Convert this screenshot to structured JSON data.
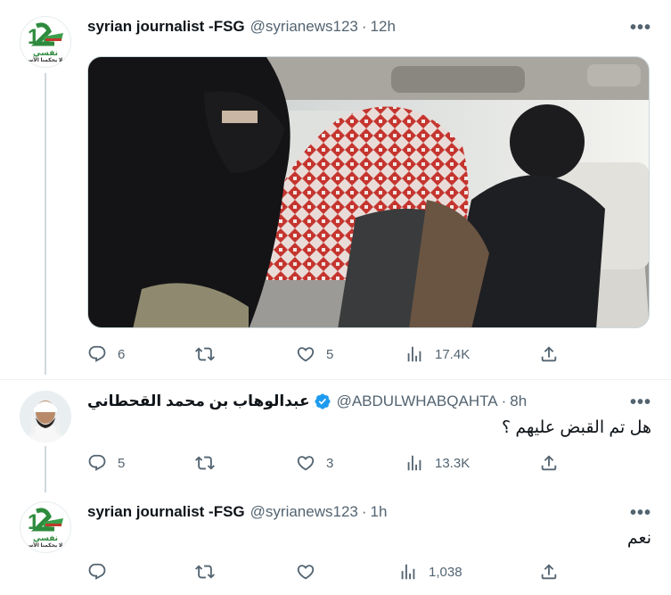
{
  "tweets": [
    {
      "name": "syrian journalist -FSG",
      "handle": "@syrianews123",
      "time": "12h",
      "replies": "6",
      "retweets": "",
      "likes": "5",
      "views": "17.4K",
      "avatar_caption_1": "نفسي",
      "avatar_caption_2": "ولا يحكمنا الأسد"
    },
    {
      "name": "عبدالوهاب بن محمد القحطاني",
      "handle": "@ABDULWHABQAHTA",
      "time": "8h",
      "text": "هل تم القبض عليهم ؟",
      "replies": "5",
      "retweets": "",
      "likes": "3",
      "views": "13.3K"
    },
    {
      "name": "syrian journalist -FSG",
      "handle": "@syrianews123",
      "time": "1h",
      "text": "نعم",
      "replies": "",
      "retweets": "",
      "likes": "",
      "views": "1,038"
    }
  ],
  "separator": "·",
  "more_label": "•••",
  "icons": [
    "reply-icon",
    "retweet-icon",
    "like-icon",
    "views-icon",
    "share-icon",
    "more-icon",
    "verified-badge-icon"
  ],
  "colors": {
    "verified": "#1d9bf0",
    "muted": "#536471",
    "logo_green": "#2e8b3e"
  }
}
